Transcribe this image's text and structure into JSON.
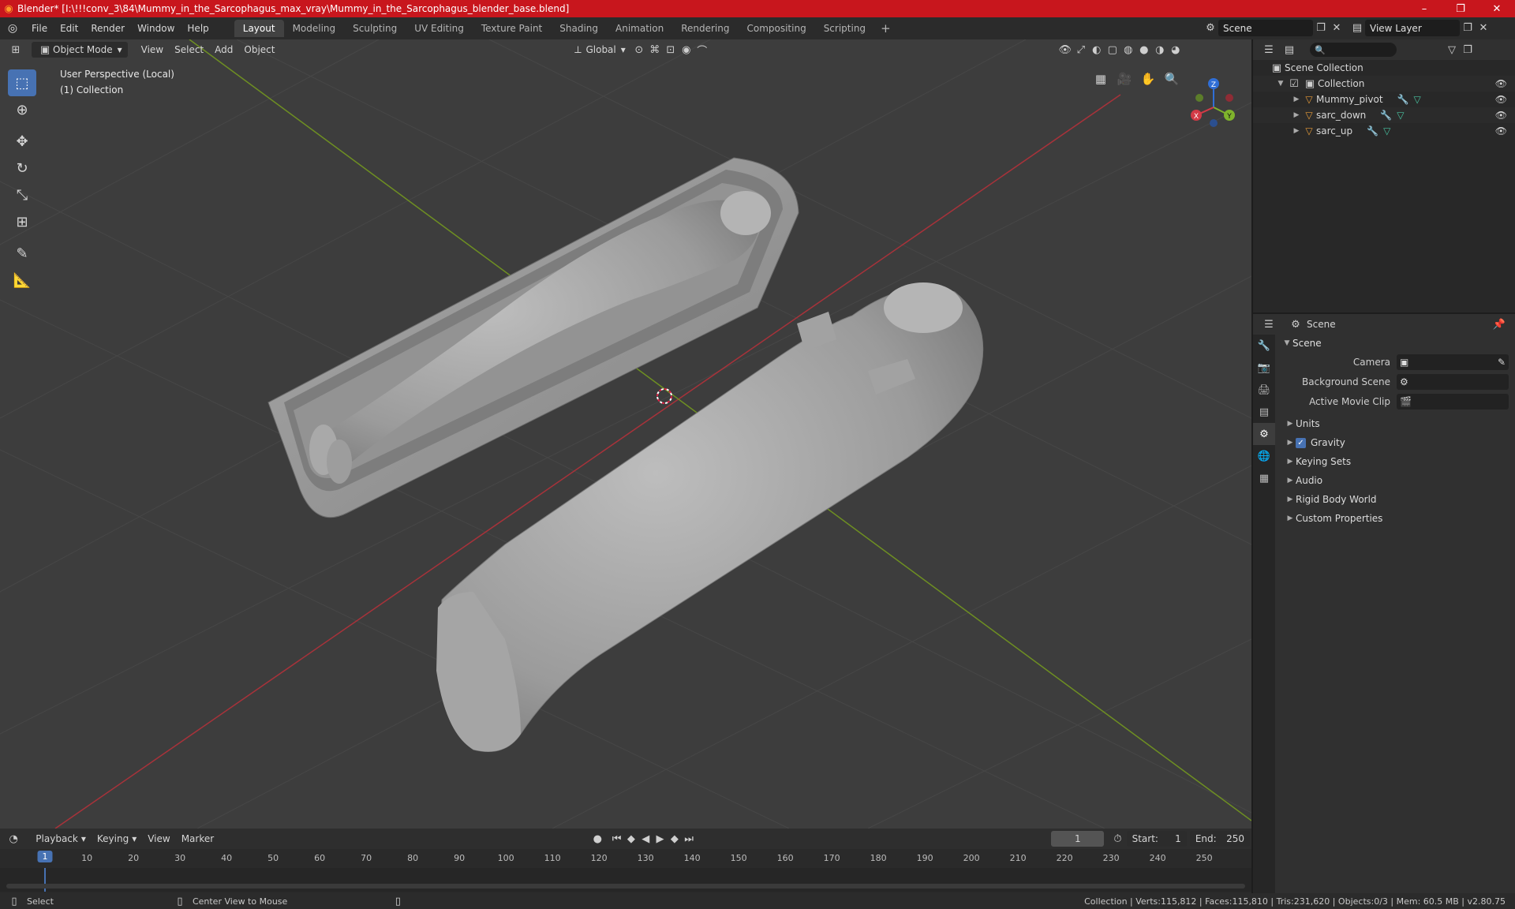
{
  "window": {
    "title": "Blender* [I:\\!!!conv_3\\84\\Mummy_in_the_Sarcophagus_max_vray\\Mummy_in_the_Sarcophagus_blender_base.blend]",
    "minimize": "–",
    "maximize": "❐",
    "close": "✕"
  },
  "menubar": {
    "items": [
      "File",
      "Edit",
      "Render",
      "Window",
      "Help"
    ],
    "tabs": [
      "Layout",
      "Modeling",
      "Sculpting",
      "UV Editing",
      "Texture Paint",
      "Shading",
      "Animation",
      "Rendering",
      "Compositing",
      "Scripting"
    ],
    "active_tab": "Layout",
    "scene": "Scene",
    "view_layer": "View Layer"
  },
  "viewport": {
    "mode": "Object Mode",
    "menus": [
      "View",
      "Select",
      "Add",
      "Object"
    ],
    "orientation": "Global",
    "info_line1": "User Perspective (Local)",
    "info_line2": "(1) Collection",
    "gizmo": {
      "x": "X",
      "y": "Y",
      "z": "Z"
    }
  },
  "outliner": {
    "search_placeholder": "",
    "root": "Scene Collection",
    "collection": "Collection",
    "objects": [
      "Mummy_pivot",
      "sarc_down",
      "sarc_up"
    ]
  },
  "properties": {
    "context": "Scene",
    "panel": "Scene",
    "rows": [
      {
        "label": "Camera",
        "value": ""
      },
      {
        "label": "Background Scene",
        "value": ""
      },
      {
        "label": "Active Movie Clip",
        "value": ""
      }
    ],
    "subpanels": [
      "Units",
      "Gravity",
      "Keying Sets",
      "Audio",
      "Rigid Body World",
      "Custom Properties"
    ]
  },
  "timeline": {
    "menus": [
      "Playback",
      "Keying",
      "View",
      "Marker"
    ],
    "current_frame": "1",
    "start_label": "Start:",
    "start": "1",
    "end_label": "End:",
    "end": "250",
    "ticks": [
      "1",
      "10",
      "20",
      "30",
      "40",
      "50",
      "60",
      "70",
      "80",
      "90",
      "100",
      "110",
      "120",
      "130",
      "140",
      "150",
      "160",
      "170",
      "180",
      "190",
      "200",
      "210",
      "220",
      "230",
      "240",
      "250"
    ]
  },
  "statusbar": {
    "left1": "Select",
    "left2": "Center View to Mouse",
    "stats": "Collection | Verts:115,812 | Faces:115,810 | Tris:231,620 | Objects:0/3 | Mem: 60.5 MB | v2.80.75"
  },
  "colors": {
    "titlebar": "#c8161d",
    "accent": "#4772b3",
    "x_axis": "#c5323c",
    "y_axis": "#8ab326"
  }
}
